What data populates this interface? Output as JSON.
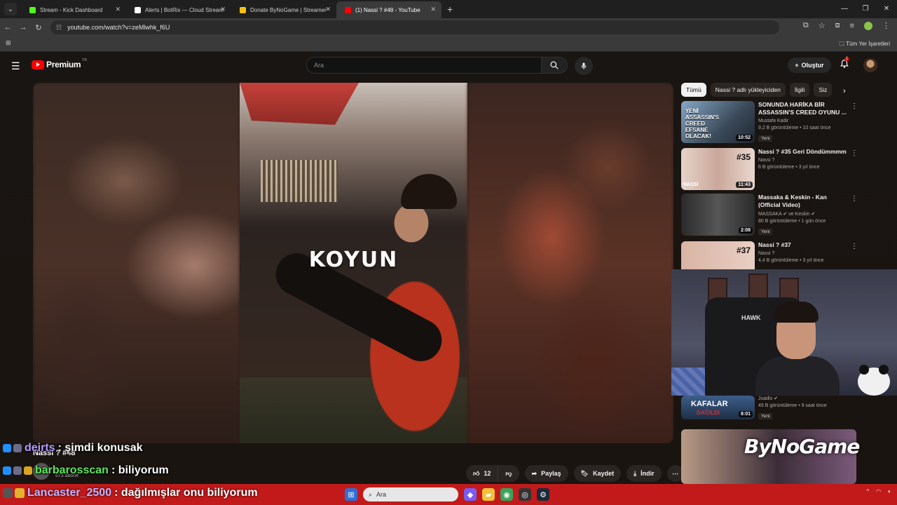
{
  "browser": {
    "tabs": [
      {
        "title": "Stream - Kick Dashboard",
        "color": "#53fc18",
        "active": false
      },
      {
        "title": "Alerts | BotRix — Cloud Stream",
        "color": "#ffffff",
        "active": false
      },
      {
        "title": "Donate ByNoGame | Streamer",
        "color": "#f1c40f",
        "active": false
      },
      {
        "title": "(1) Nassi ? #48 - YouTube",
        "color": "#ff0000",
        "active": true
      }
    ],
    "url": "youtube.com/watch?v=zeMlwhk_f6U",
    "bookmarks_all": "Tüm Yer İşaretleri"
  },
  "youtube": {
    "logo_text": "Premium",
    "logo_country": "TR",
    "search_placeholder": "Ara",
    "create_label": "Oluştur",
    "notification_count": "1"
  },
  "video": {
    "overlay_text": "KOYUN",
    "title": "Nassi ? #48",
    "subscribers": "673 abone",
    "likes": "12",
    "share_label": "Paylaş",
    "save_label": "Kaydet",
    "download_label": "İndir"
  },
  "chips": [
    "Tümü",
    "Nassi ? adlı yükleyiciden",
    "İlgili",
    "Siz"
  ],
  "recommendations": [
    {
      "title": "SONUNDA HARİKA BİR ASSASSIN'S CREED OYUNU ...",
      "channel": "Mustafa Kadir",
      "stats": "9,2 B görüntüleme • 10 saat önce",
      "badge": "Yeni",
      "duration": "10:52",
      "thumb_text": "YENİ ASSASSIN'S CREED EFSANE OLACAK!"
    },
    {
      "title": "Nassi ? #35 Geri Döndümmmm",
      "channel": "Nassi ?",
      "stats": "6 B görüntüleme • 3 yıl önce",
      "badge": "",
      "duration": "11:43",
      "thumb_num": "#35",
      "thumb_text": "NASSİ"
    },
    {
      "title": "Massaka & Keskin - Kan (Official Video)",
      "channel": "MASSAKA ✔ ve Keskin ✔",
      "stats": "80 B görüntüleme • 1 gün önce",
      "badge": "Yeni",
      "duration": "2:08"
    },
    {
      "title": "Nassi ? #37",
      "channel": "Nassi ?",
      "stats": "4,4 B görüntüleme • 3 yıl önce",
      "badge": "",
      "duration": "",
      "thumb_num": "#37"
    },
    {
      "title": "",
      "channel": "Juadis ✔",
      "stats": "49 B görüntüleme • 9 saat önce",
      "badge": "Yeni",
      "duration": "8:01",
      "thumb_text": "KAFALAR",
      "thumb_text2": "DAĞILDI"
    }
  ],
  "webcam": {
    "chair_brand": "HAWK"
  },
  "chat": [
    {
      "user": "deirts",
      "msg": ": şimdi konusak",
      "user_color": "#b69cff"
    },
    {
      "user": "barbarosscan",
      "msg": ": biliyorum",
      "user_color": "#5ce65c"
    }
  ],
  "ticker": {
    "user": "Lancaster_2500",
    "msg": ": dağılmışlar onu biliyorum"
  },
  "donation_brand": "ByNoGame",
  "taskbar": {
    "search_placeholder": "Ara"
  }
}
